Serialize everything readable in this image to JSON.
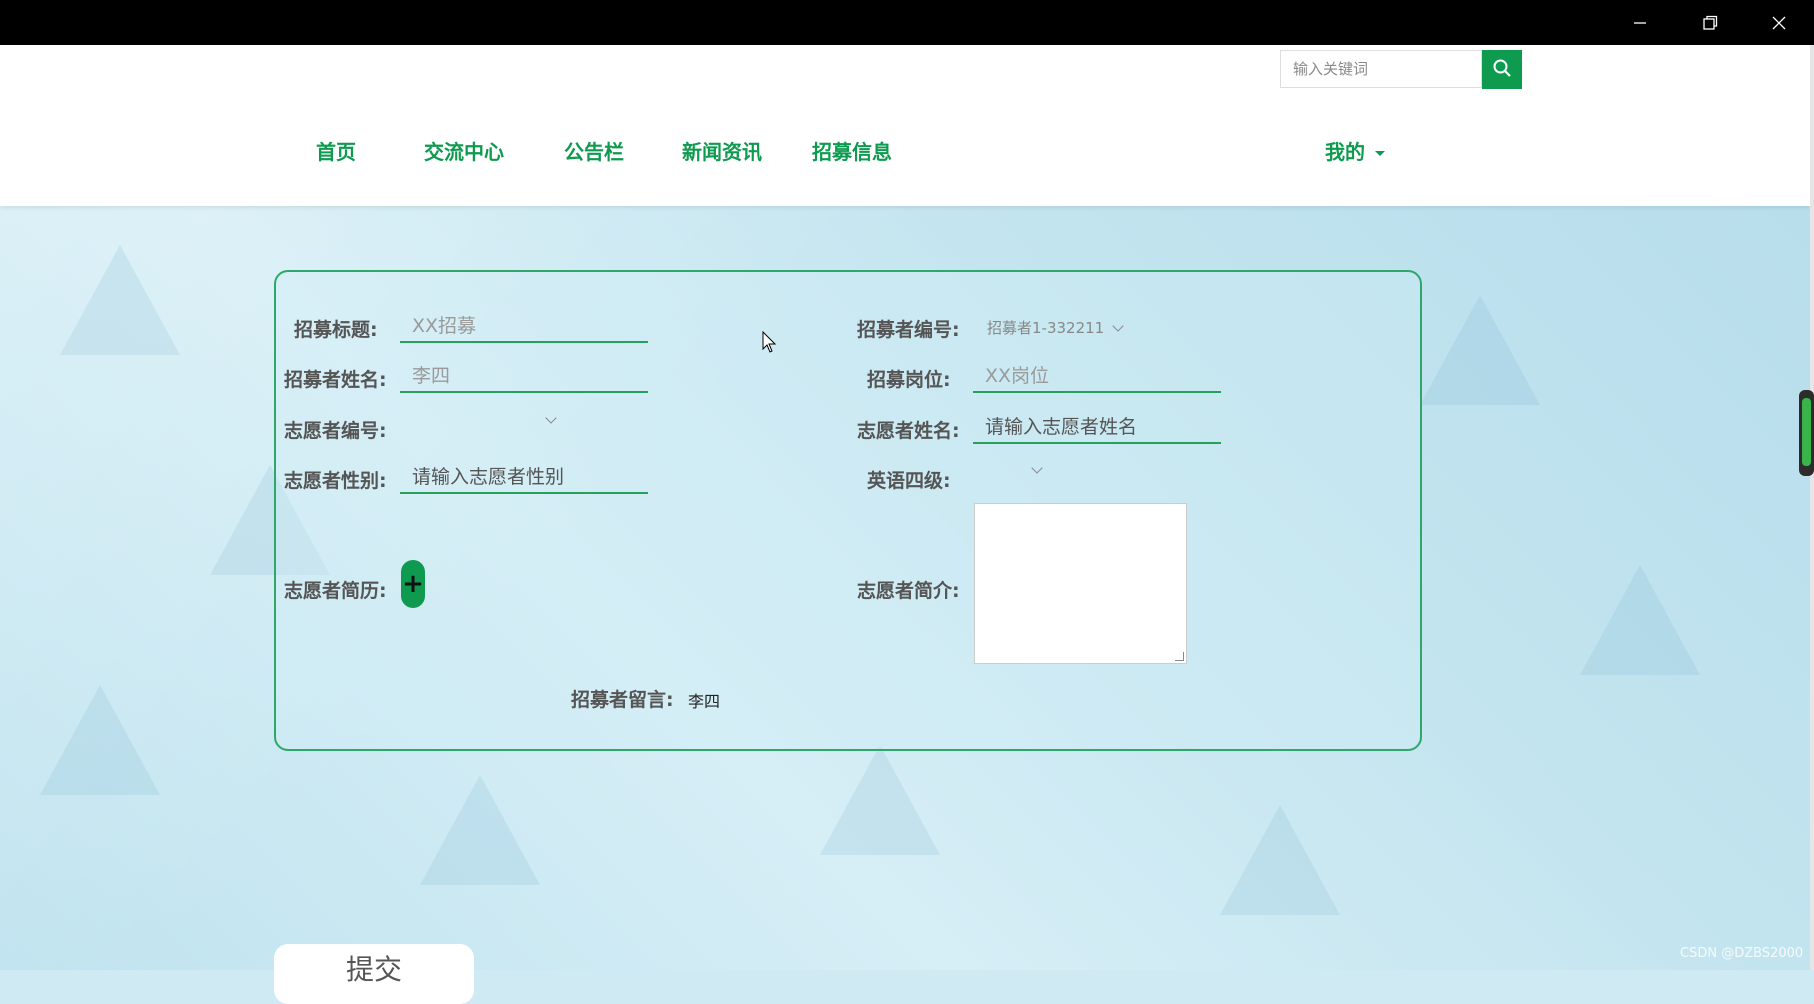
{
  "search": {
    "placeholder": "输入关键词"
  },
  "nav": {
    "items": [
      {
        "label": "首页"
      },
      {
        "label": "交流中心"
      },
      {
        "label": "公告栏"
      },
      {
        "label": "新闻资讯"
      },
      {
        "label": "招募信息"
      }
    ],
    "user_menu": "我的"
  },
  "form": {
    "title_label": "招募标题:",
    "title_value": "XX招募",
    "recruiter_id_label": "招募者编号:",
    "recruiter_id_value": "招募者1-332211",
    "recruiter_name_label": "招募者姓名:",
    "recruiter_name_value": "李四",
    "position_label": "招募岗位:",
    "position_value": "XX岗位",
    "volunteer_id_label": "志愿者编号:",
    "volunteer_id_value": "",
    "volunteer_name_label": "志愿者姓名:",
    "volunteer_name_placeholder": "请输入志愿者姓名",
    "volunteer_gender_label": "志愿者性别:",
    "volunteer_gender_placeholder": "请输入志愿者性别",
    "cet4_label": "英语四级:",
    "cet4_value": "",
    "resume_label": "志愿者简历:",
    "resume_button": "+",
    "intro_label": "志愿者简介:",
    "message_label": "招募者留言:",
    "message_value": "李四"
  },
  "submit_label": "提交",
  "watermark": "CSDN @DZBS2000"
}
